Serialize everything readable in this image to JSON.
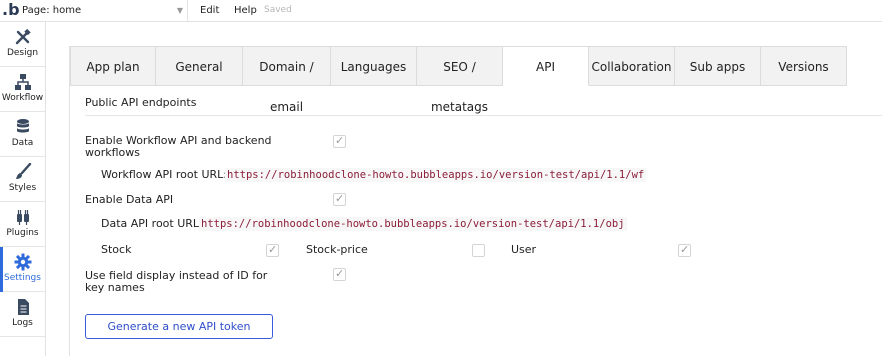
{
  "topbar": {
    "logo": ".b",
    "page_select": "Page: home",
    "menu": {
      "edit": "Edit",
      "help": "Help",
      "saved": "Saved"
    }
  },
  "sidebar": {
    "items": [
      {
        "label": "Design",
        "icon": "design-icon"
      },
      {
        "label": "Workflow",
        "icon": "workflow-icon"
      },
      {
        "label": "Data",
        "icon": "data-icon"
      },
      {
        "label": "Styles",
        "icon": "styles-icon"
      },
      {
        "label": "Plugins",
        "icon": "plugins-icon"
      },
      {
        "label": "Settings",
        "icon": "gear-icon",
        "active": true
      },
      {
        "label": "Logs",
        "icon": "logs-icon"
      }
    ]
  },
  "tabs": [
    {
      "label": "App plan"
    },
    {
      "label": "General"
    },
    {
      "label": "Domain / email"
    },
    {
      "label": "Languages"
    },
    {
      "label": "SEO / metatags"
    },
    {
      "label": "API",
      "active": true
    },
    {
      "label": "Collaboration"
    },
    {
      "label": "Sub apps"
    },
    {
      "label": "Versions"
    }
  ],
  "api": {
    "section_title": "Public API endpoints",
    "workflow_api_label": "Enable Workflow API and backend workflows",
    "workflow_api_checked": true,
    "workflow_root_label": "Workflow API root URL:",
    "workflow_root_url": "https://robinhoodclone-howto.bubbleapps.io/version-test/api/1.1/wf",
    "data_api_label": "Enable Data API",
    "data_api_checked": true,
    "data_root_label": "Data API root URL:",
    "data_root_url": "https://robinhoodclone-howto.bubbleapps.io/version-test/api/1.1/obj",
    "types": [
      {
        "label": "Stock",
        "checked": true
      },
      {
        "label": "Stock-price",
        "checked": false
      },
      {
        "label": "User",
        "checked": true
      }
    ],
    "field_display_label": "Use field display instead of ID for key names",
    "field_display_checked": true,
    "generate_button": "Generate a new API token"
  },
  "colors": {
    "accent": "#2f6bda",
    "url_text": "#8b1d3a",
    "button_border": "#3b5bdb"
  }
}
